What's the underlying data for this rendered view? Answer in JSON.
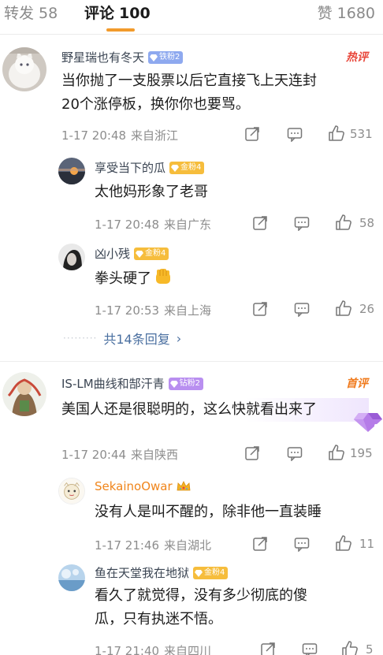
{
  "tabs": {
    "repost": {
      "label": "转发",
      "count": "58"
    },
    "comments": {
      "label": "评论",
      "count": "100"
    },
    "likes": {
      "label": "赞",
      "count": "1680"
    }
  },
  "comments": [
    {
      "user": "野星瑞也有冬天",
      "badge": "铁粉2",
      "tag": "热评",
      "text_lines": [
        "当你抛了一支股票以后它直接飞上天连封",
        "20个涨停板，换你你也要骂。"
      ],
      "time": "1-17 20:48",
      "location": "来自浙江",
      "likes": "531",
      "replies": [
        {
          "user": "享受当下的瓜",
          "badge": "金粉4",
          "text": "太他妈形象了老哥",
          "time": "1-17 20:48",
          "location": "来自广东",
          "likes": "58"
        },
        {
          "user": "凶小残",
          "badge": "金粉4",
          "text": "拳头硬了",
          "time": "1-17 20:53",
          "location": "来自上海",
          "likes": "26"
        }
      ],
      "reply_link": "共14条回复"
    },
    {
      "user": "IS-LM曲线和郜汗青",
      "badge": "钻粉2",
      "tag": "首评",
      "text_lines": [
        "美国人还是很聪明的，这么快就看出来了"
      ],
      "time": "1-17 20:44",
      "location": "来自陕西",
      "likes": "195",
      "replies": [
        {
          "user": "SekainoOwar",
          "text": "没有人是叫不醒的，除非他一直装睡",
          "time": "1-17 21:46",
          "location": "来自湖北",
          "likes": "11"
        },
        {
          "user": "鱼在天堂我在地狱",
          "badge": "金粉4",
          "text_lines": [
            "看久了就觉得，没有多少彻底的傻",
            "瓜，只有执迷不悟。"
          ],
          "time": "1-17 21:40",
          "location": "来自四川",
          "likes": "5"
        }
      ]
    }
  ],
  "colors": {
    "accent": "#f29b2c",
    "link": "#4a6fa0",
    "hot": "#e8473b",
    "first": "#f07a1c"
  },
  "icons": [
    "share-icon",
    "comment-icon",
    "like-icon",
    "badge-gem-icon",
    "crown-icon",
    "fist-emoji",
    "diamond-icon"
  ]
}
